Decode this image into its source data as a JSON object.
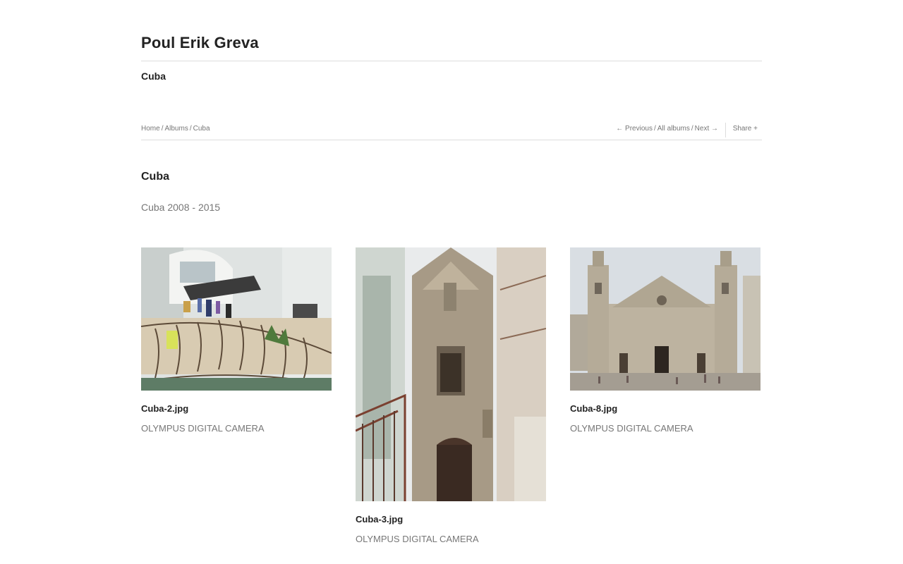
{
  "site": {
    "title": "Poul Erik Greva",
    "subtitle": "Cuba"
  },
  "breadcrumb": {
    "home": "Home",
    "albums": "Albums",
    "current": "Cuba",
    "separator": "/"
  },
  "pager": {
    "previous": "← Previous",
    "all_albums": "All albums",
    "next": "Next →",
    "separator": "/"
  },
  "share": {
    "label": "Share +"
  },
  "album": {
    "title": "Cuba",
    "description": "Cuba 2008 - 2015"
  },
  "photos": [
    {
      "filename": "Cuba-2.jpg",
      "caption": "OLYMPUS DIGITAL CAMERA",
      "subject": "balcony-with-laundry"
    },
    {
      "filename": "Cuba-3.jpg",
      "caption": "OLYMPUS DIGITAL CAMERA",
      "subject": "church-facade-street"
    },
    {
      "filename": "Cuba-8.jpg",
      "caption": "OLYMPUS DIGITAL CAMERA",
      "subject": "havana-cathedral"
    }
  ],
  "colors": {
    "text_dark": "#222222",
    "text_muted": "#777777",
    "rule": "#dddddd"
  }
}
